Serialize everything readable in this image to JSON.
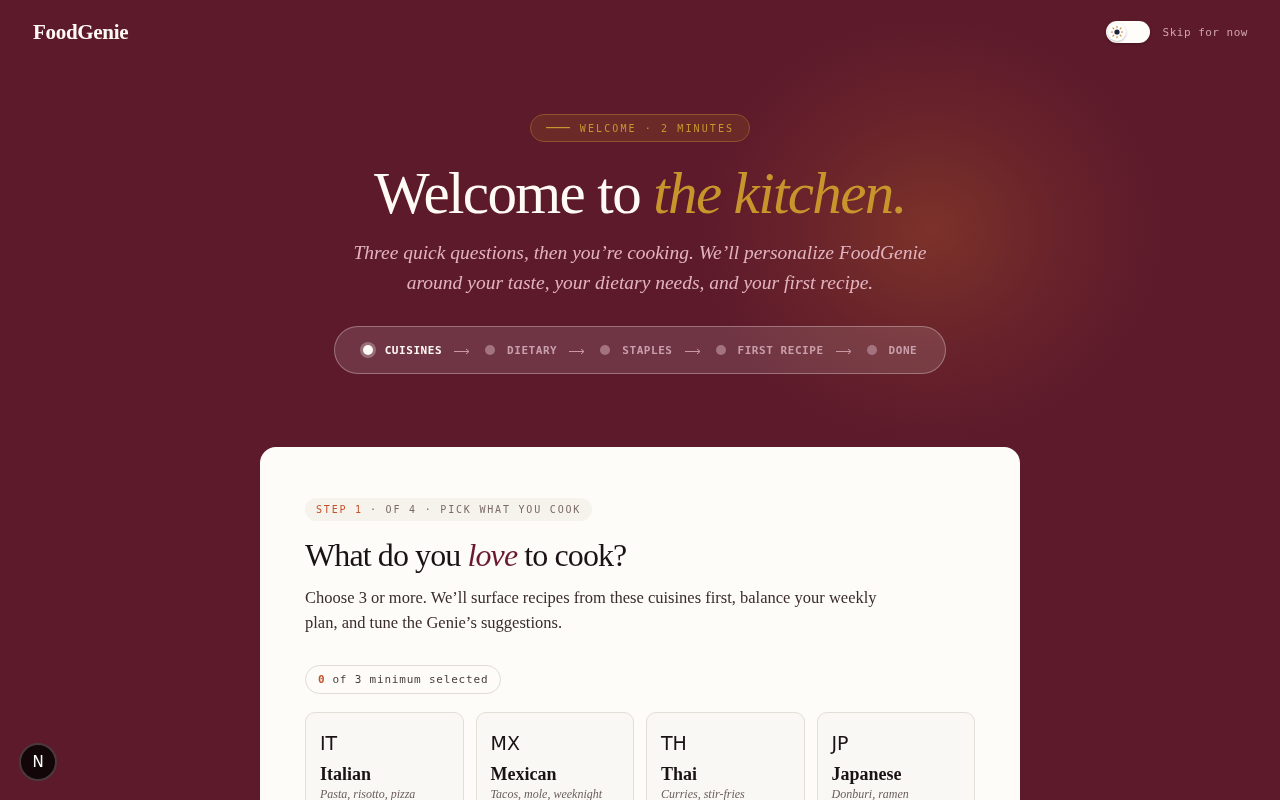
{
  "header": {
    "logo": "FoodGenie",
    "theme_toggle": {
      "on": false
    },
    "skip_link": "Skip for now"
  },
  "hero": {
    "badge": "WELCOME · 2 MINUTES",
    "title": "Welcome to *the kitchen.*",
    "subtitle": "Three quick questions, then you’re cooking. We’ll personalize FoodGenie around your taste, your dietary needs, and your first recipe."
  },
  "steps": [
    {
      "label": "CUISINES",
      "current": true
    },
    {
      "label": "DIETARY",
      "current": false
    },
    {
      "label": "STAPLES",
      "current": false
    },
    {
      "label": "FIRST RECIPE",
      "current": false
    },
    {
      "label": "DONE",
      "current": false
    }
  ],
  "card": {
    "step_tag": {
      "step": "STEP 1",
      "text": "· OF 4 · PICK WHAT YOU COOK"
    },
    "question": "What do you *love* to cook?",
    "description": "Choose 3 or more. We’ll surface recipes from these cuisines first, balance your weekly plan, and tune the Genie’s suggestions.",
    "counter": {
      "count": "0",
      "text": "of 3 minimum selected"
    },
    "cuisines": [
      {
        "code": "IT",
        "name": "Italian",
        "description": "Pasta, risotto, pizza",
        "selected": false
      },
      {
        "code": "MX",
        "name": "Mexican",
        "description": "Tacos, mole, weeknight",
        "selected": false
      },
      {
        "code": "TH",
        "name": "Thai",
        "description": "Curries, stir-fries",
        "selected": false
      },
      {
        "code": "JP",
        "name": "Japanese",
        "description": "Donburi, ramen",
        "selected": false
      }
    ]
  },
  "dev_badge": {
    "label": "N"
  }
}
